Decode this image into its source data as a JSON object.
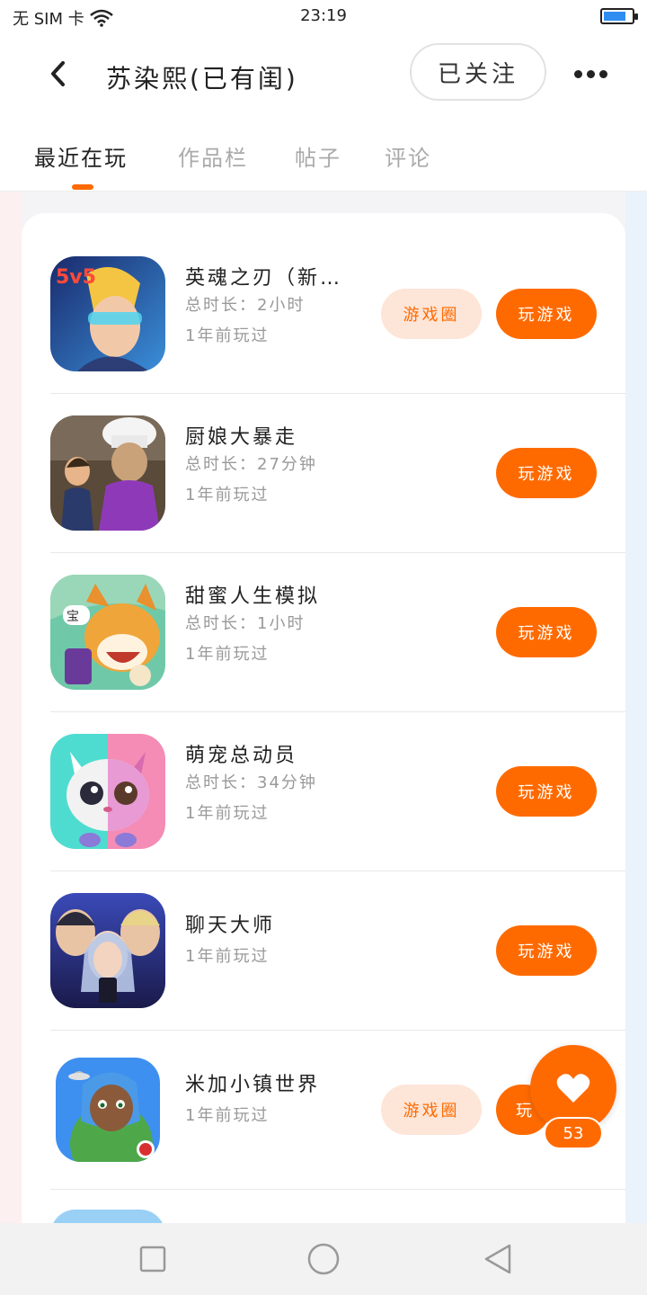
{
  "status_bar": {
    "carrier": "无 SIM 卡",
    "time": "23:19"
  },
  "header": {
    "title": "苏染熙(已有闺)",
    "follow_label": "已关注"
  },
  "tabs": [
    {
      "label": "最近在玩",
      "active": true
    },
    {
      "label": "作品栏",
      "active": false
    },
    {
      "label": "帖子",
      "active": false
    },
    {
      "label": "评论",
      "active": false
    }
  ],
  "games": [
    {
      "name": "英魂之刃（新…",
      "duration": "总时长：2小时",
      "last_played": "1年前玩过",
      "circle_label": "游戏圈",
      "play_label": "玩游戏",
      "icon": "hero-game-icon"
    },
    {
      "name": "厨娘大暴走",
      "duration": "总时长：27分钟",
      "last_played": "1年前玩过",
      "play_label": "玩游戏",
      "icon": "chef-game-icon"
    },
    {
      "name": "甜蜜人生模拟",
      "duration": "总时长：1小时",
      "last_played": "1年前玩过",
      "play_label": "玩游戏",
      "icon": "dog-game-icon"
    },
    {
      "name": "萌宠总动员",
      "duration": "总时长：34分钟",
      "last_played": "1年前玩过",
      "play_label": "玩游戏",
      "icon": "pet-game-icon"
    },
    {
      "name": "聊天大师",
      "last_played": "1年前玩过",
      "play_label": "玩游戏",
      "icon": "chat-game-icon"
    },
    {
      "name": "米加小镇世界",
      "last_played": "1年前玩过",
      "circle_label": "游戏圈",
      "play_label": "玩",
      "icon": "town-game-icon"
    }
  ],
  "like": {
    "count": "53"
  },
  "colors": {
    "accent": "#ff6a00",
    "accent_light": "#fde5d8"
  }
}
